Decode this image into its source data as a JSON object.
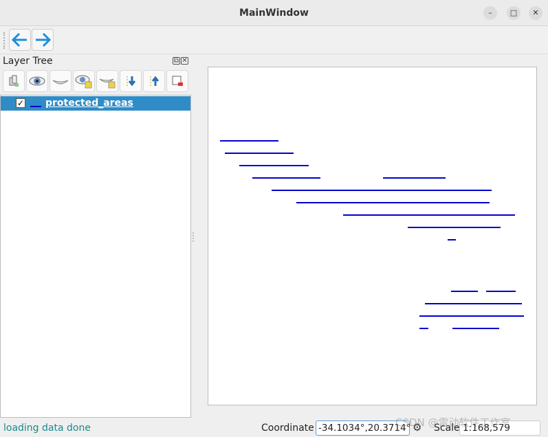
{
  "window": {
    "title": "MainWindow",
    "minimize": "–",
    "maximize": "□",
    "close": "✕"
  },
  "toolbar": {
    "back": "back-arrow",
    "forward": "forward-arrow"
  },
  "layer_panel": {
    "title": "Layer Tree",
    "tools": [
      "add-group",
      "show-all",
      "hide-all",
      "show-selected",
      "hide-selected",
      "move-down",
      "move-up",
      "remove-layer"
    ],
    "layers": [
      {
        "name": "protected_areas",
        "checked": true,
        "checkmark": "✓",
        "color": "#0000cc"
      }
    ]
  },
  "statusbar": {
    "message": "loading data done",
    "coordinate_label": "Coordinate",
    "coordinate": "-34.1034°,20.3714°",
    "scale_label": "Scale",
    "scale": "1:168,579"
  },
  "watermark": "CSDN @雷动软件工作室",
  "colors": {
    "accent": "#308cc6",
    "feature": "#0000cc",
    "status": "#1a8a8a"
  }
}
